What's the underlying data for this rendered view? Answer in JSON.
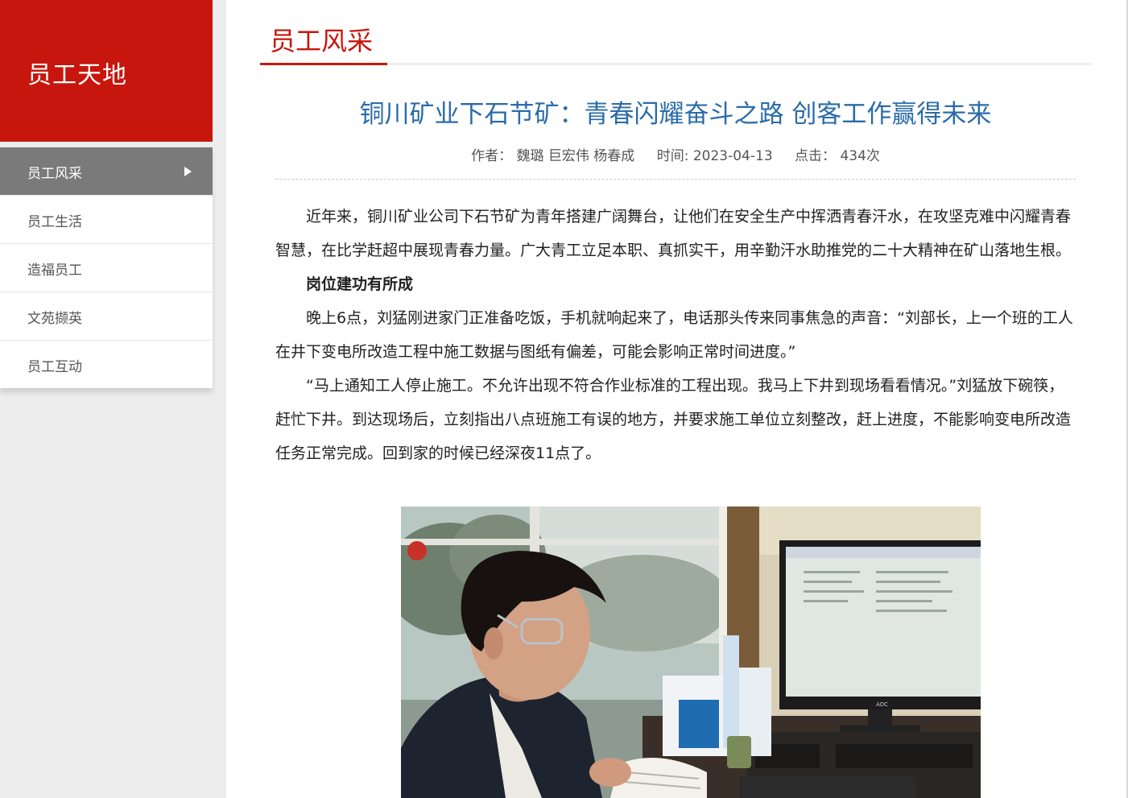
{
  "sidebar": {
    "title": "员工天地",
    "items": [
      {
        "label": "员工风采",
        "active": true
      },
      {
        "label": "员工生活"
      },
      {
        "label": "造福员工"
      },
      {
        "label": "文苑撷英"
      },
      {
        "label": "员工互动"
      }
    ]
  },
  "section": {
    "title": "员工风采"
  },
  "article": {
    "title": "铜川矿业下石节矿：青春闪耀奋斗之路 创客工作赢得未来",
    "author": "作者：  魏璐 巨宏伟 杨春成",
    "date": "时间: 2023-04-13",
    "clicks": "点击：  434次",
    "paragraphs": [
      "近年来，铜川矿业公司下石节矿为青年搭建广阔舞台，让他们在安全生产中挥洒青春汗水，在攻坚克难中闪耀青春智慧，在比学赶超中展现青春力量。广大青工立足本职、真抓实干，用辛勤汗水助推党的二十大精神在矿山落地生根。",
      "岗位建功有所成",
      "晚上6点，刘猛刚进家门正准备吃饭，手机就响起来了，电话那头传来同事焦急的声音：“刘部长，上一个班的工人在井下变电所改造工程中施工数据与图纸有偏差，可能会影响正常时间进度。”",
      "“马上通知工人停止施工。不允许出现不符合作业标准的工程出现。我马上下井到现场看看情况。”刘猛放下碗筷，赶忙下井。到达现场后，立刻指出八点班施工有误的地方，并要求施工单位立刻整改，赶上进度，不能影响变电所改造任务正常完成。回到家的时候已经深夜11点了。"
    ],
    "photo_monitor_brand": "AOC"
  }
}
